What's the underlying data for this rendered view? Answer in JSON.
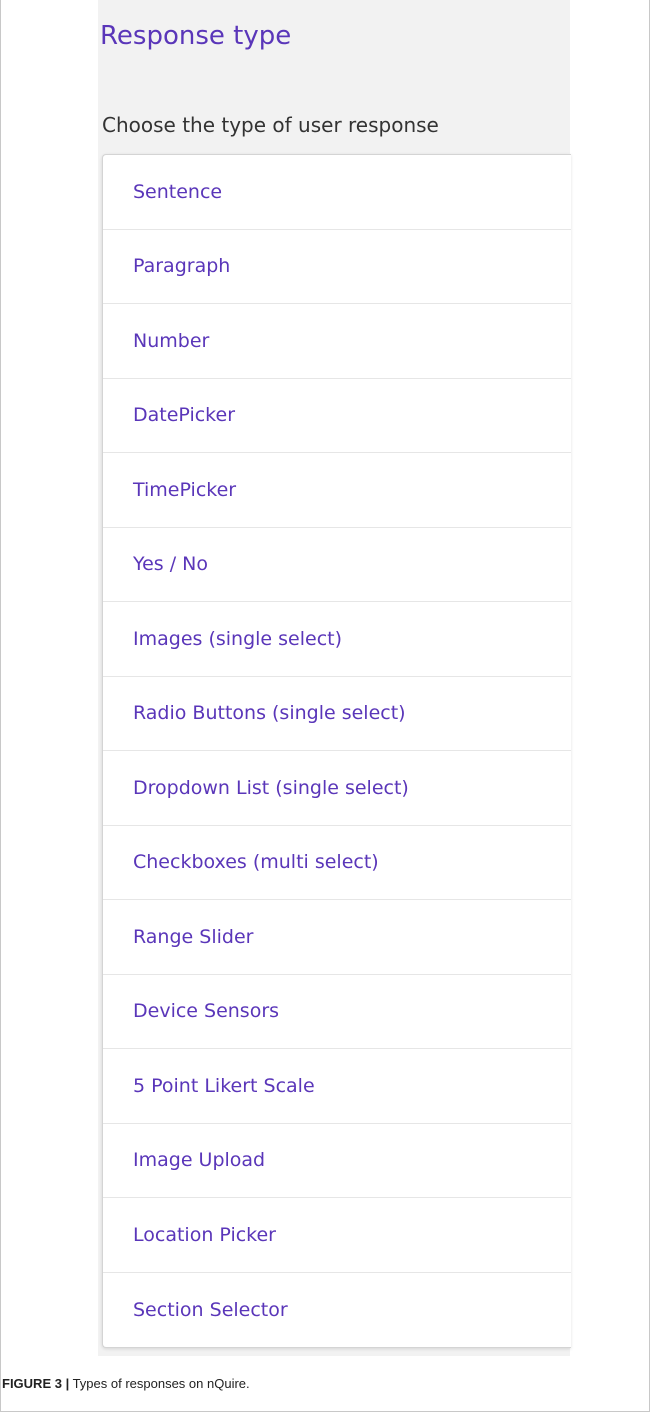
{
  "header": {
    "title": "Response type"
  },
  "subtitle": "Choose the type of user response",
  "response_types": [
    {
      "label": "Sentence"
    },
    {
      "label": "Paragraph"
    },
    {
      "label": "Number"
    },
    {
      "label": "DatePicker"
    },
    {
      "label": "TimePicker"
    },
    {
      "label": "Yes / No"
    },
    {
      "label": "Images (single select)"
    },
    {
      "label": "Radio Buttons (single select)"
    },
    {
      "label": "Dropdown List (single select)"
    },
    {
      "label": "Checkboxes (multi select)"
    },
    {
      "label": "Range Slider"
    },
    {
      "label": "Device Sensors"
    },
    {
      "label": "5 Point Likert Scale"
    },
    {
      "label": "Image Upload"
    },
    {
      "label": "Location Picker"
    },
    {
      "label": "Section Selector"
    }
  ],
  "caption": {
    "label": "FIGURE 3 |",
    "text": " Types of responses on nQuire."
  },
  "colors": {
    "accent": "#5a36b9",
    "panel_bg": "#f2f2f2",
    "text": "#333333"
  }
}
